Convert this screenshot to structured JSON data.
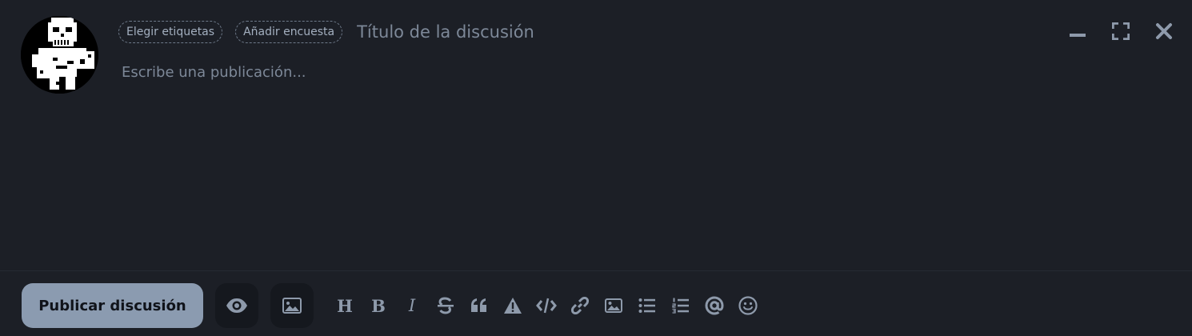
{
  "composer": {
    "choose_tags_label": "Elegir etiquetas",
    "add_poll_label": "Añadir encuesta",
    "title_placeholder": "Título de la discusión",
    "body_placeholder": "Escribe una publicación..."
  },
  "window_controls": {
    "minimize_icon": "minimize-icon",
    "fullscreen_icon": "fullscreen-icon",
    "close_icon": "close-icon"
  },
  "footer": {
    "publish_label": "Publicar discusión",
    "preview_icon": "eye-icon",
    "image_upload_icon": "image-icon"
  },
  "format_toolbar": {
    "heading_text": "H",
    "bold_text": "B",
    "italic_text": "I",
    "icons": [
      "heading-icon",
      "bold-icon",
      "italic-icon",
      "strikethrough-icon",
      "quote-icon",
      "spoiler-warning-icon",
      "code-icon",
      "link-icon",
      "image-icon",
      "bullet-list-icon",
      "numbered-list-icon",
      "mention-icon",
      "emoji-icon"
    ]
  },
  "colors": {
    "background": "#1c1f26",
    "publish_button": "#8b9bb0",
    "icon": "#8e9aab",
    "placeholder": "#7d8898"
  }
}
